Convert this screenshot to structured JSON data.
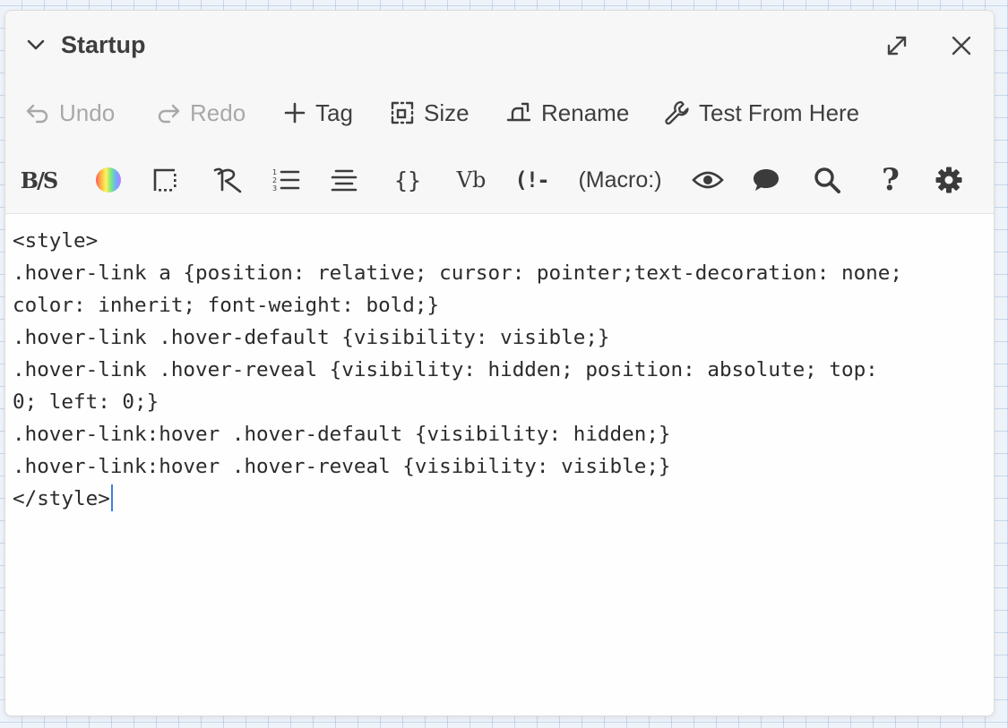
{
  "dialog": {
    "title": "Startup",
    "controls": {
      "collapse_icon": "chevron-down-icon",
      "maximize_icon": "maximize-icon",
      "close_icon": "close-icon"
    }
  },
  "toolbar": {
    "items": [
      {
        "label": "Undo",
        "icon": "undo-icon",
        "enabled": false
      },
      {
        "label": "Redo",
        "icon": "redo-icon",
        "enabled": false
      },
      {
        "label": "Tag",
        "icon": "plus-icon",
        "enabled": true
      },
      {
        "label": "Size",
        "icon": "size-icon",
        "enabled": true
      },
      {
        "label": "Rename",
        "icon": "rename-icon",
        "enabled": true
      },
      {
        "label": "Test From Here",
        "icon": "wrench-icon",
        "enabled": true
      }
    ]
  },
  "format_toolbar": {
    "bold_strike_label": "B/S",
    "verbatim_label": "Vb",
    "comment_label": "(!-",
    "macro_label": "(Macro:)",
    "help_label": "?"
  },
  "editor": {
    "lines": [
      "<style>",
      ".hover-link a {position: relative; cursor: pointer;text-decoration: none;",
      "color: inherit; font-weight: bold;}",
      ".hover-link .hover-default {visibility: visible;}",
      ".hover-link .hover-reveal {visibility: hidden; position: absolute; top:",
      "0; left: 0;}",
      ".hover-link:hover .hover-default {visibility: hidden;}",
      ".hover-link:hover .hover-reveal {visibility: visible;}",
      "</style>"
    ]
  },
  "colors": {
    "accent": "#3b7ee8",
    "text": "#3f3f3f",
    "disabled": "#a8a8a8"
  }
}
